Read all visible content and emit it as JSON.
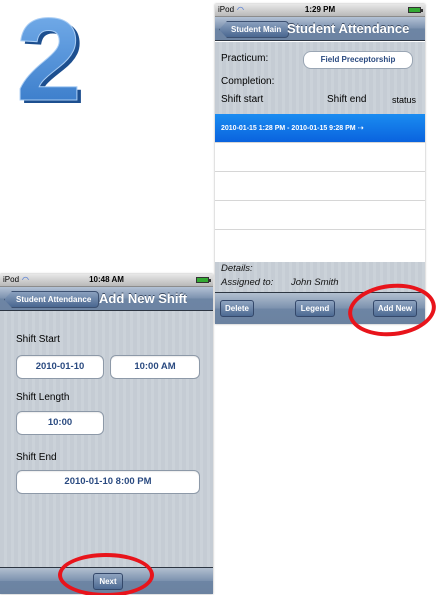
{
  "step": "2",
  "screen1": {
    "status": {
      "carrier": "iPod",
      "time": "1:29 PM"
    },
    "nav": {
      "back_label": "Student Main",
      "title": "Student Attendance"
    },
    "practicum_label": "Practicum:",
    "practicum_value": "Field Preceptorship",
    "completion_label": "Completion:",
    "columns": {
      "shift_start": "Shift start",
      "shift_end": "Shift end",
      "status": "status"
    },
    "rows": [
      {
        "text": "2010-01-15 1:28 PM - 2010-01-15 9:28 PM  ⇢"
      }
    ],
    "details_label": "Details:",
    "assigned_label": "Assigned to:",
    "assigned_value": "John Smith",
    "toolbar": {
      "delete": "Delete",
      "legend": "Legend",
      "add_new": "Add New"
    }
  },
  "screen2": {
    "status": {
      "carrier": "iPod",
      "time": "10:48 AM"
    },
    "nav": {
      "back_label": "Student Attendance",
      "title": "Add New Shift"
    },
    "shift_start_label": "Shift Start",
    "shift_start_date": "2010-01-10",
    "shift_start_time": "10:00 AM",
    "shift_length_label": "Shift Length",
    "shift_length_value": "10:00",
    "shift_end_label": "Shift End",
    "shift_end_value": "2010-01-10 8:00 PM",
    "toolbar": {
      "next": "Next"
    }
  },
  "colors": {
    "highlight_ring": "#e8141b",
    "selection_blue": "#0a63de",
    "number_blue": "#3f86d6"
  }
}
